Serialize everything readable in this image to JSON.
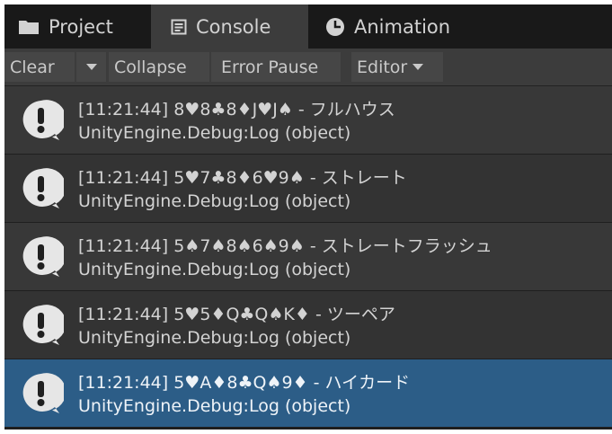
{
  "tabs": [
    {
      "label": "Project",
      "icon": "folder-icon"
    },
    {
      "label": "Console",
      "icon": "console-icon"
    },
    {
      "label": "Animation",
      "icon": "animation-icon"
    }
  ],
  "toolbar": {
    "clear_label": "Clear",
    "collapse_label": "Collapse",
    "error_pause_label": "Error Pause",
    "editor_label": "Editor"
  },
  "colors": {
    "row_even": "#383838",
    "row_odd": "#333333",
    "row_selected": "#2c5d87",
    "icon_fill": "#e6e6e6",
    "icon_mark": "#202020"
  },
  "logs": [
    {
      "message": "[11:21:44] 8♥8♣8♦J♥J♠ - フルハウス",
      "trace": "UnityEngine.Debug:Log (object)",
      "icon": "info-icon",
      "selected": false
    },
    {
      "message": "[11:21:44] 5♥7♣8♦6♥9♠ - ストレート",
      "trace": "UnityEngine.Debug:Log (object)",
      "icon": "info-icon",
      "selected": false
    },
    {
      "message": "[11:21:44] 5♠7♠8♠6♠9♠ - ストレートフラッシュ",
      "trace": "UnityEngine.Debug:Log (object)",
      "icon": "info-icon",
      "selected": false
    },
    {
      "message": "[11:21:44] 5♥5♦Q♣Q♠K♦ - ツーペア",
      "trace": "UnityEngine.Debug:Log (object)",
      "icon": "info-icon",
      "selected": false
    },
    {
      "message": "[11:21:44] 5♥A♦8♣Q♠9♦ - ハイカード",
      "trace": "UnityEngine.Debug:Log (object)",
      "icon": "info-icon",
      "selected": true
    }
  ]
}
